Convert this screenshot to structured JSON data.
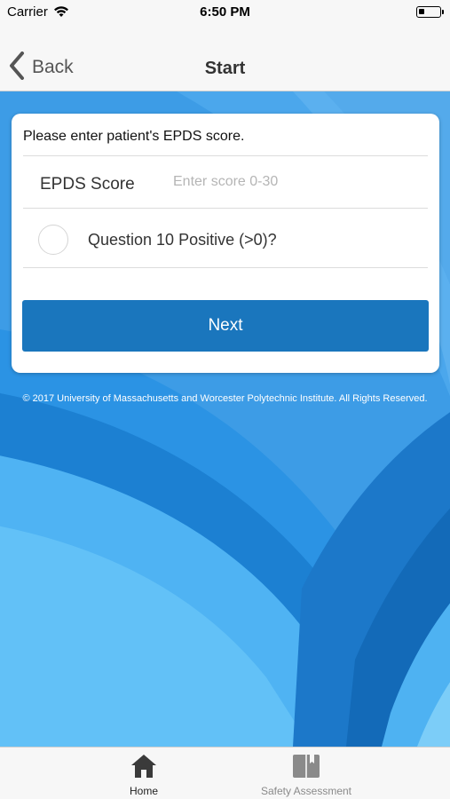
{
  "status_bar": {
    "carrier": "Carrier",
    "time": "6:50 PM"
  },
  "nav": {
    "back_label": "Back",
    "title": "Start"
  },
  "form": {
    "prompt": "Please enter patient's EPDS score.",
    "score_label": "EPDS Score",
    "score_placeholder": "Enter score 0-30",
    "score_value": "",
    "question_label": "Question 10 Positive (>0)?",
    "question_checked": false,
    "next_label": "Next"
  },
  "copyright": "© 2017 University of Massachusetts and Worcester Polytechnic Institute. All Rights Reserved.",
  "tabs": [
    {
      "label": "Home",
      "icon": "home-icon",
      "selected": true
    },
    {
      "label": "Safety Assessment",
      "icon": "book-icon",
      "selected": false
    }
  ],
  "colors": {
    "accent": "#1a76bd",
    "background_blue": "#2a8de0",
    "light_blue": "#5bb8f5",
    "dark_blue": "#1565b4"
  }
}
